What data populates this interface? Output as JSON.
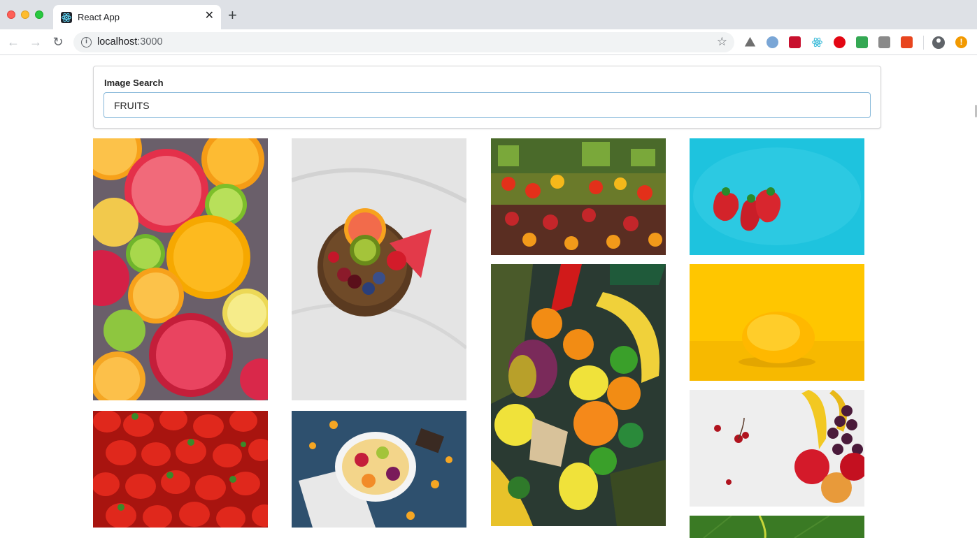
{
  "browser": {
    "tab_title": "React App",
    "tab_close": "✕",
    "new_tab": "+",
    "url_host": "localhost",
    "url_port": ":3000",
    "nav": {
      "back": "←",
      "forward": "→",
      "reload": "↻"
    },
    "star": "☆",
    "info": "i",
    "alert": "!",
    "extensions": [
      "google-drive-icon",
      "safari-extension-icon",
      "adblock-extension-icon",
      "react-devtools-icon",
      "adobe-acrobat-icon",
      "checkmark-extension-icon",
      "camera-icon",
      "c-extension-icon"
    ]
  },
  "search": {
    "label": "Image Search",
    "value": "FRUITS"
  },
  "images": [
    {
      "name": "citrus-slices-image",
      "accent": "#f5a623"
    },
    {
      "name": "fruit-bowl-marble-image",
      "accent": "#e0e0e0"
    },
    {
      "name": "market-produce-image",
      "accent": "#3d5a2a"
    },
    {
      "name": "strawberries-blue-image",
      "accent": "#1ec3de"
    },
    {
      "name": "strawberry-pile-image",
      "accent": "#d3221a"
    },
    {
      "name": "fruit-plate-dark-image",
      "accent": "#2a4a66"
    },
    {
      "name": "mixed-fruits-pineapple-image",
      "accent": "#2e3a2a"
    },
    {
      "name": "lemon-yellow-image",
      "accent": "#ffc600"
    },
    {
      "name": "banana-cherries-white-image",
      "accent": "#f0f0f0"
    },
    {
      "name": "green-leaf-image",
      "accent": "#2f6b1e"
    }
  ]
}
